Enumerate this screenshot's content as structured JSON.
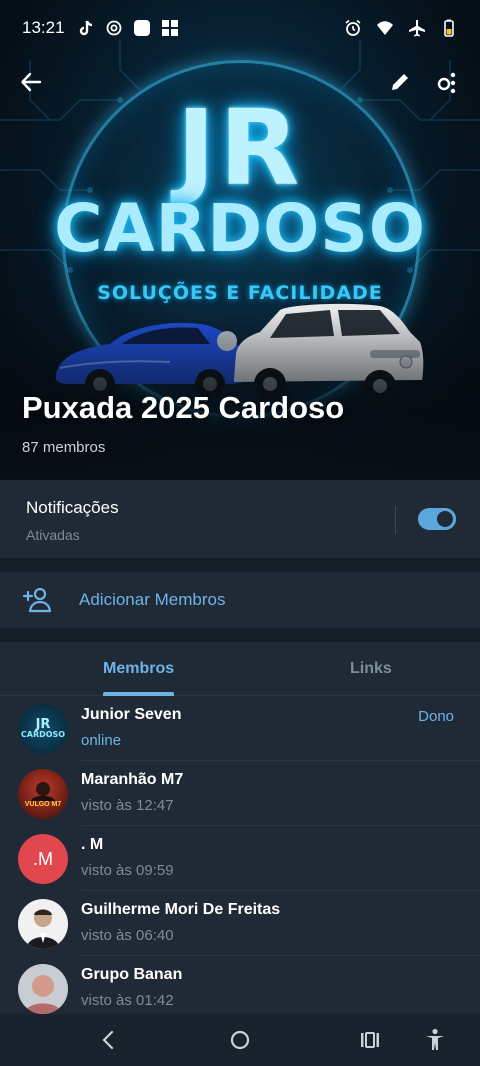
{
  "status_bar": {
    "time": "13:21",
    "left_icons": [
      "tiktok-icon",
      "instagram-icon",
      "app-icon",
      "microsoft-icon"
    ],
    "right_icons": [
      "alarm-icon",
      "wifi-icon",
      "airplane-icon",
      "battery-icon"
    ]
  },
  "header": {
    "banner": {
      "line1": "JR",
      "line2": "CARDOSO",
      "line3": "SOLUÇÕES E FACILIDADE"
    },
    "group_name": "Puxada 2025 Cardoso",
    "member_count": "87 membros",
    "actions": [
      "back-icon",
      "edit-icon",
      "more-icon"
    ]
  },
  "notifications": {
    "title": "Notificações",
    "status": "Ativadas",
    "enabled": true
  },
  "add_members": {
    "label": "Adicionar Membros"
  },
  "tabs": [
    {
      "label": "Membros",
      "active": true
    },
    {
      "label": "Links",
      "active": false
    }
  ],
  "members": [
    {
      "name": "Junior Seven",
      "status": "online",
      "role": "Dono",
      "avatar_type": "logo"
    },
    {
      "name": "Maranhão M7",
      "status": "visto às 12:47",
      "role": "",
      "avatar_type": "photo"
    },
    {
      "name": ". M",
      "status": "visto às 09:59",
      "role": "",
      "avatar_type": "initials",
      "initials": ".M",
      "avatar_color": "#e0474f"
    },
    {
      "name": "Guilherme Mori De Freitas",
      "status": "visto às 06:40",
      "role": "",
      "avatar_type": "photo"
    },
    {
      "name": "Grupo Banan",
      "status": "visto às 01:42",
      "role": "",
      "avatar_type": "photo"
    }
  ],
  "avatar_logo": {
    "line1": "JR",
    "line2": "CARDOSO"
  },
  "avatar_maranhao_text": "VULGO M7",
  "colors": {
    "accent": "#6db3e6",
    "background": "#1f2a36",
    "separator": "#151d26"
  }
}
